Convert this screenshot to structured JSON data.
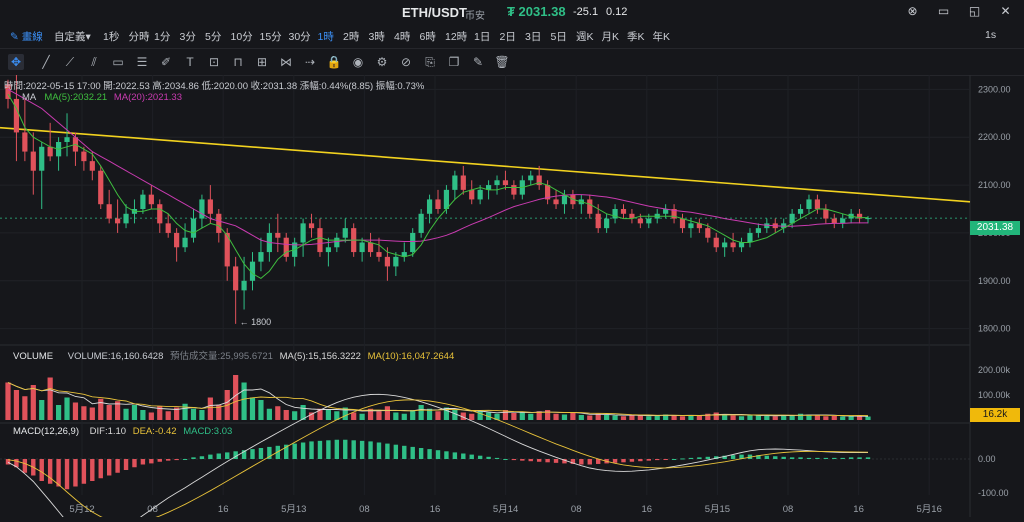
{
  "header": {
    "pair": "ETH/USDT",
    "exchange": "币安",
    "price": "₮ 2031.38",
    "change": "-25.1",
    "change_pct": "0.12"
  },
  "timeframes": {
    "draw_label": "畫線",
    "custom_label": "自定義",
    "items": [
      "1秒",
      "分時",
      "1分",
      "3分",
      "5分",
      "10分",
      "15分",
      "30分",
      "1時",
      "2時",
      "3時",
      "4時",
      "6時",
      "12時",
      "1日",
      "2日",
      "3日",
      "5日",
      "週K",
      "月K",
      "季K",
      "年K"
    ],
    "active": "1時",
    "interval_right": "1s"
  },
  "legend": {
    "ohlc": "時間:2022-05-15 17:00  開:2022.53  高:2034.86  低:2020.00  收:2031.38  漲幅:0.44%(8.85)  振幅:0.73%",
    "ma_label": "MA",
    "ma5": "MA(5):2032.21",
    "ma20": "MA(20):2021.33",
    "volume_label": "VOLUME",
    "volume_val": "VOLUME:16,160.6428",
    "volume_est": "預估成交量:25,995.6721",
    "vma5": "MA(5):15,156.3222",
    "vma10": "MA(10):16,047.2644",
    "macd_label": "MACD(12,26,9)",
    "dif": "DIF:1.10",
    "dea": "DEA:-0.42",
    "macd": "MACD:3.03"
  },
  "badges": {
    "price": "2031.38",
    "volume": "16.2k",
    "low_marker": "← 1800"
  },
  "colors": {
    "up": "#2fbf87",
    "down": "#e0525b",
    "ma5": "#3fbf3f",
    "ma20": "#c93bb0",
    "trendline": "#f2d21f",
    "vma5": "#d9d9d9",
    "vma10": "#e8c23a"
  },
  "chart_data": {
    "type": "candlestick",
    "price_axis_ticks": [
      1800,
      1900,
      2000,
      2100,
      2200,
      2300
    ],
    "price_range": [
      1770,
      2330
    ],
    "volume_axis_ticks": [
      "200.00k",
      "100.00k"
    ],
    "macd_axis_ticks": [
      "0.00",
      "-100.00"
    ],
    "x_labels": [
      "5月12",
      "08",
      "16",
      "5月13",
      "08",
      "16",
      "5月14",
      "08",
      "16",
      "5月15",
      "08",
      "16",
      "5月16"
    ],
    "candles": [
      [
        2310,
        2320,
        2260,
        2280
      ],
      [
        2280,
        2400,
        2150,
        2210
      ],
      [
        2210,
        2280,
        2150,
        2170
      ],
      [
        2170,
        2210,
        2080,
        2130
      ],
      [
        2130,
        2190,
        2050,
        2180
      ],
      [
        2180,
        2230,
        2150,
        2160
      ],
      [
        2160,
        2200,
        2130,
        2190
      ],
      [
        2190,
        2250,
        2160,
        2200
      ],
      [
        2200,
        2210,
        2140,
        2170
      ],
      [
        2170,
        2180,
        2130,
        2150
      ],
      [
        2150,
        2170,
        2110,
        2130
      ],
      [
        2130,
        2140,
        2050,
        2060
      ],
      [
        2060,
        2090,
        2020,
        2030
      ],
      [
        2030,
        2070,
        2000,
        2020
      ],
      [
        2020,
        2060,
        2010,
        2040
      ],
      [
        2040,
        2070,
        2020,
        2050
      ],
      [
        2050,
        2090,
        2040,
        2080
      ],
      [
        2080,
        2100,
        2050,
        2060
      ],
      [
        2060,
        2070,
        2000,
        2020
      ],
      [
        2020,
        2040,
        1990,
        2000
      ],
      [
        2000,
        2010,
        1940,
        1970
      ],
      [
        1970,
        2020,
        1960,
        1990
      ],
      [
        1990,
        2050,
        1980,
        2030
      ],
      [
        2030,
        2080,
        2010,
        2070
      ],
      [
        2070,
        2100,
        2020,
        2040
      ],
      [
        2040,
        2050,
        1980,
        2000
      ],
      [
        2000,
        2010,
        1900,
        1930
      ],
      [
        1930,
        1950,
        1810,
        1880
      ],
      [
        1880,
        1950,
        1840,
        1900
      ],
      [
        1900,
        1960,
        1880,
        1940
      ],
      [
        1940,
        1990,
        1920,
        1960
      ],
      [
        1960,
        2020,
        1940,
        2000
      ],
      [
        2000,
        2040,
        1960,
        1990
      ],
      [
        1990,
        2000,
        1940,
        1950
      ],
      [
        1950,
        1990,
        1930,
        1980
      ],
      [
        1980,
        2030,
        1950,
        2020
      ],
      [
        2020,
        2040,
        1990,
        2010
      ],
      [
        2010,
        2030,
        1950,
        1960
      ],
      [
        1960,
        1990,
        1930,
        1970
      ],
      [
        1970,
        2000,
        1960,
        1990
      ],
      [
        1990,
        2030,
        1980,
        2010
      ],
      [
        2010,
        2020,
        1950,
        1960
      ],
      [
        1960,
        1990,
        1940,
        1980
      ],
      [
        1980,
        2000,
        1950,
        1960
      ],
      [
        1960,
        1990,
        1940,
        1950
      ],
      [
        1950,
        1970,
        1900,
        1930
      ],
      [
        1930,
        1960,
        1910,
        1950
      ],
      [
        1950,
        1980,
        1940,
        1960
      ],
      [
        1960,
        2010,
        1950,
        2000
      ],
      [
        2000,
        2050,
        1990,
        2040
      ],
      [
        2040,
        2080,
        2020,
        2070
      ],
      [
        2070,
        2090,
        2040,
        2050
      ],
      [
        2050,
        2100,
        2040,
        2090
      ],
      [
        2090,
        2130,
        2070,
        2120
      ],
      [
        2120,
        2140,
        2080,
        2090
      ],
      [
        2090,
        2110,
        2060,
        2070
      ],
      [
        2070,
        2100,
        2060,
        2090
      ],
      [
        2090,
        2110,
        2070,
        2100
      ],
      [
        2100,
        2120,
        2080,
        2110
      ],
      [
        2110,
        2130,
        2090,
        2100
      ],
      [
        2100,
        2110,
        2070,
        2080
      ],
      [
        2080,
        2120,
        2070,
        2110
      ],
      [
        2110,
        2130,
        2100,
        2120
      ],
      [
        2120,
        2140,
        2090,
        2100
      ],
      [
        2100,
        2110,
        2060,
        2070
      ],
      [
        2070,
        2090,
        2050,
        2060
      ],
      [
        2060,
        2090,
        2040,
        2080
      ],
      [
        2080,
        2090,
        2050,
        2060
      ],
      [
        2060,
        2080,
        2040,
        2070
      ],
      [
        2070,
        2080,
        2030,
        2040
      ],
      [
        2040,
        2060,
        2000,
        2010
      ],
      [
        2010,
        2040,
        2000,
        2030
      ],
      [
        2030,
        2060,
        2020,
        2050
      ],
      [
        2050,
        2060,
        2030,
        2040
      ],
      [
        2040,
        2050,
        2020,
        2030
      ],
      [
        2030,
        2040,
        2010,
        2020
      ],
      [
        2020,
        2040,
        2010,
        2030
      ],
      [
        2030,
        2050,
        2020,
        2040
      ],
      [
        2040,
        2060,
        2030,
        2050
      ],
      [
        2050,
        2060,
        2020,
        2030
      ],
      [
        2030,
        2040,
        2000,
        2010
      ],
      [
        2010,
        2030,
        1990,
        2020
      ],
      [
        2020,
        2030,
        2000,
        2010
      ],
      [
        2010,
        2020,
        1980,
        1990
      ],
      [
        1990,
        2000,
        1960,
        1970
      ],
      [
        1970,
        1990,
        1950,
        1980
      ],
      [
        1980,
        2000,
        1960,
        1970
      ],
      [
        1970,
        1990,
        1960,
        1980
      ],
      [
        1980,
        2010,
        1970,
        2000
      ],
      [
        2000,
        2020,
        1990,
        2010
      ],
      [
        2010,
        2030,
        2000,
        2020
      ],
      [
        2020,
        2030,
        2000,
        2010
      ],
      [
        2010,
        2030,
        2000,
        2020
      ],
      [
        2020,
        2050,
        2010,
        2040
      ],
      [
        2040,
        2060,
        2030,
        2050
      ],
      [
        2050,
        2080,
        2040,
        2070
      ],
      [
        2070,
        2080,
        2040,
        2050
      ],
      [
        2050,
        2060,
        2020,
        2030
      ],
      [
        2030,
        2040,
        2010,
        2020
      ],
      [
        2020,
        2040,
        2010,
        2030
      ],
      [
        2030,
        2050,
        2020,
        2040
      ],
      [
        2040,
        2050,
        2020,
        2030
      ],
      [
        2030,
        2035,
        2020,
        2031
      ]
    ],
    "ma5": [
      2290,
      2260,
      2220,
      2200,
      2190,
      2180,
      2175,
      2180,
      2185,
      2175,
      2165,
      2140,
      2110,
      2080,
      2055,
      2045,
      2045,
      2050,
      2050,
      2040,
      2020,
      2005,
      2000,
      2010,
      2020,
      2015,
      1995,
      1965,
      1935,
      1915,
      1905,
      1920,
      1945,
      1960,
      1965,
      1975,
      1985,
      1990,
      1985,
      1985,
      1985,
      1985,
      1985,
      1980,
      1975,
      1960,
      1955,
      1950,
      1955,
      1975,
      2005,
      2030,
      2050,
      2070,
      2085,
      2090,
      2095,
      2090,
      2090,
      2095,
      2095,
      2095,
      2100,
      2105,
      2100,
      2090,
      2080,
      2070,
      2065,
      2060,
      2050,
      2040,
      2035,
      2030,
      2030,
      2035,
      2035,
      2035,
      2035,
      2035,
      2030,
      2025,
      2020,
      2015,
      2005,
      1995,
      1985,
      1980,
      1980,
      1985,
      1990,
      2000,
      2010,
      2020,
      2030,
      2040,
      2050,
      2050,
      2045,
      2040,
      2035,
      2032,
      2032
    ],
    "ma20": [
      2300,
      2290,
      2280,
      2270,
      2260,
      2245,
      2230,
      2215,
      2200,
      2185,
      2170,
      2160,
      2150,
      2140,
      2130,
      2120,
      2110,
      2100,
      2090,
      2080,
      2070,
      2060,
      2050,
      2040,
      2030,
      2025,
      2020,
      2015,
      2005,
      1995,
      1985,
      1980,
      1978,
      1976,
      1975,
      1975,
      1976,
      1978,
      1980,
      1982,
      1984,
      1985,
      1985,
      1985,
      1985,
      1984,
      1983,
      1982,
      1982,
      1983,
      1986,
      1990,
      1995,
      2002,
      2010,
      2018,
      2025,
      2032,
      2040,
      2048,
      2055,
      2060,
      2065,
      2070,
      2074,
      2077,
      2079,
      2080,
      2080,
      2079,
      2077,
      2075,
      2072,
      2068,
      2064,
      2060,
      2056,
      2053,
      2050,
      2047,
      2045,
      2043,
      2040,
      2037,
      2034,
      2030,
      2027,
      2024,
      2021,
      2018,
      2016,
      2015,
      2014,
      2014,
      2015,
      2016,
      2018,
      2019,
      2020,
      2020,
      2021,
      2021,
      2021
    ],
    "trendline": {
      "start": 2220,
      "end": 2065
    },
    "volume": [
      150,
      120,
      95,
      140,
      80,
      170,
      60,
      90,
      70,
      55,
      50,
      85,
      60,
      75,
      45,
      60,
      40,
      30,
      55,
      35,
      50,
      65,
      45,
      40,
      90,
      60,
      120,
      180,
      150,
      90,
      80,
      45,
      55,
      40,
      35,
      60,
      30,
      45,
      40,
      35,
      50,
      30,
      25,
      45,
      35,
      55,
      30,
      25,
      40,
      60,
      45,
      35,
      50,
      40,
      30,
      25,
      35,
      30,
      25,
      40,
      28,
      30,
      25,
      35,
      40,
      25,
      22,
      30,
      20,
      18,
      25,
      20,
      18,
      15,
      20,
      18,
      15,
      20,
      22,
      18,
      15,
      20,
      18,
      25,
      30,
      22,
      18,
      15,
      20,
      18,
      16,
      15,
      18,
      20,
      25,
      22,
      18,
      15,
      16,
      14,
      15,
      16,
      14
    ],
    "macd": [
      -10,
      -15,
      -25,
      -30,
      -40,
      -45,
      -50,
      -55,
      -50,
      -45,
      -40,
      -35,
      -30,
      -25,
      -20,
      -15,
      -10,
      -8,
      -5,
      -3,
      -2,
      0,
      3,
      5,
      8,
      10,
      12,
      14,
      16,
      18,
      20,
      22,
      24,
      26,
      28,
      30,
      32,
      33,
      34,
      35,
      35,
      34,
      33,
      32,
      30,
      28,
      26,
      24,
      22,
      20,
      18,
      16,
      14,
      12,
      10,
      8,
      6,
      4,
      2,
      0,
      -2,
      -3,
      -4,
      -5,
      -6,
      -7,
      -8,
      -9,
      -10,
      -10,
      -9,
      -8,
      -7,
      -6,
      -5,
      -4,
      -3,
      -2,
      -1,
      0,
      1,
      2,
      3,
      4,
      5,
      6,
      7,
      8,
      8,
      7,
      6,
      5,
      4,
      3,
      3,
      2,
      2,
      2,
      2,
      2,
      3,
      3,
      3
    ]
  }
}
